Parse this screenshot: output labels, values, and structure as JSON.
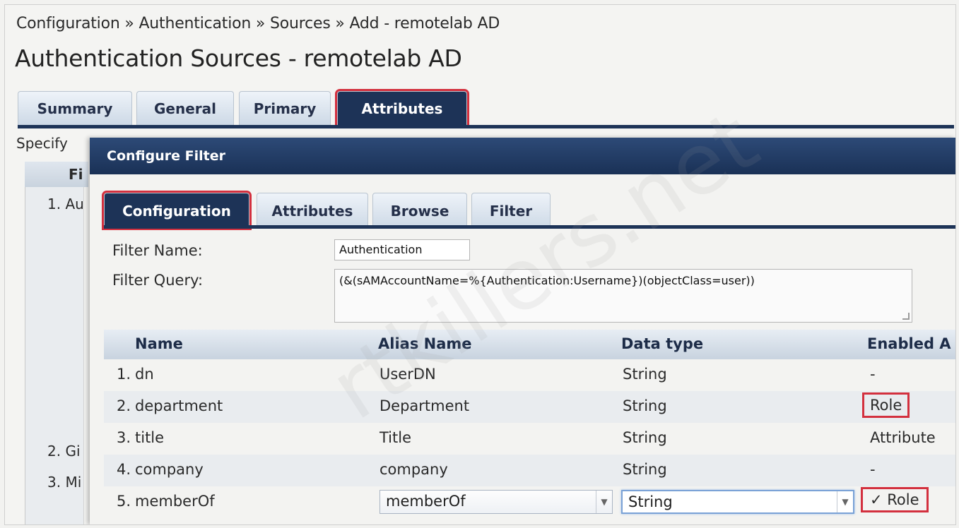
{
  "breadcrumb": "Configuration » Authentication » Sources » Add - remotelab AD",
  "page_title": "Authentication Sources - remotelab AD",
  "outer_tabs": [
    {
      "label": "Summary"
    },
    {
      "label": "General"
    },
    {
      "label": "Primary"
    },
    {
      "label": "Attributes"
    }
  ],
  "background": {
    "specify": "Specify",
    "header_frag": "Fi",
    "row1": "1. Au",
    "row2": "2. Gi",
    "row3": "3. Mi"
  },
  "modal": {
    "title": "Configure Filter",
    "tabs": [
      {
        "label": "Configuration"
      },
      {
        "label": "Attributes"
      },
      {
        "label": "Browse"
      },
      {
        "label": "Filter"
      }
    ],
    "filter_name_label": "Filter Name:",
    "filter_name_value": "Authentication",
    "filter_query_label": "Filter Query:",
    "filter_query_value": "(&(sAMAccountName=%{Authentication:Username})(objectClass=user))",
    "table": {
      "headers": {
        "name": "Name",
        "alias": "Alias Name",
        "type": "Data type",
        "enabled": "Enabled A"
      },
      "rows": [
        {
          "num": "1.",
          "name": "dn",
          "alias": "UserDN",
          "type": "String",
          "enabled": "-"
        },
        {
          "num": "2.",
          "name": "department",
          "alias": "Department",
          "type": "String",
          "enabled": "Role"
        },
        {
          "num": "3.",
          "name": "title",
          "alias": "Title",
          "type": "String",
          "enabled": "Attribute"
        },
        {
          "num": "4.",
          "name": "company",
          "alias": "company",
          "type": "String",
          "enabled": "-"
        },
        {
          "num": "5.",
          "name": "memberOf",
          "alias": "memberOf",
          "type": "String",
          "enabled": "✓ Role"
        }
      ]
    }
  },
  "watermark": "rtkillers.net",
  "colors": {
    "nav_dark": "#1d3357",
    "highlight_red": "#d3303e"
  }
}
